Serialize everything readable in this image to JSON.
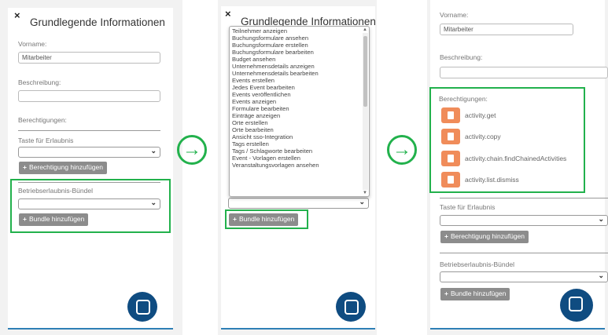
{
  "panel1": {
    "close_label": "×",
    "title": "Grundlegende Informationen",
    "vorname_label": "Vorname:",
    "vorname_value": "Mitarbeiter",
    "beschreibung_label": "Beschreibung:",
    "beschreibung_value": "",
    "berechtigungen_label": "Berechtigungen:",
    "taste_label": "Taste für Erlaubnis",
    "add_permission_label": "Berechtigung hinzufügen",
    "bundle_label": "Betriebserlaubnis-Bündel",
    "add_bundle_label": "Bundle hinzufügen"
  },
  "panel2": {
    "close_label": "×",
    "title": "Grundlegende Informationen",
    "add_bundle_label": "Bundle hinzufügen",
    "options": [
      "Teilnehmer anzeigen",
      "Buchungsformulare ansehen",
      "Buchungsformulare erstellen",
      "Buchungsformulare bearbeiten",
      "Budget ansehen",
      "Unternehmensdetails anzeigen",
      "Unternehmensdetails bearbeiten",
      "Events erstellen",
      "Jedes Event bearbeiten",
      "Events veröffentlichen",
      "Events anzeigen",
      "Formulare bearbeiten",
      "Einträge anzeigen",
      "Orte erstellen",
      "Orte bearbeiten",
      "Ansicht sso-Integration",
      "Tags erstellen",
      "Tags / Schlagworte bearbeiten",
      "Event - Vorlagen erstellen",
      "Veranstaltungsvorlagen ansehen"
    ]
  },
  "panel3": {
    "vorname_label": "Vorname:",
    "vorname_value": "Mitarbeiter",
    "beschreibung_label": "Beschreibung:",
    "beschreibung_value": "",
    "berechtigungen_label": "Berechtigungen:",
    "permissions": [
      "activity.get",
      "activity.copy",
      "activity.chain.findChainedActivities",
      "activity.list.dismiss"
    ],
    "taste_label": "Taste für Erlaubnis",
    "add_permission_label": "Berechtigung hinzufügen",
    "bundle_label": "Betriebserlaubnis-Bündel",
    "add_bundle_label": "Bundle hinzufügen"
  },
  "colors": {
    "highlight": "#22b14c",
    "chat": "#0f4c81",
    "permission_icon": "#f08c5a",
    "button": "#8c8c8c"
  },
  "icons": {
    "arrow": "→",
    "plus": "+",
    "chevron": "⌄"
  }
}
